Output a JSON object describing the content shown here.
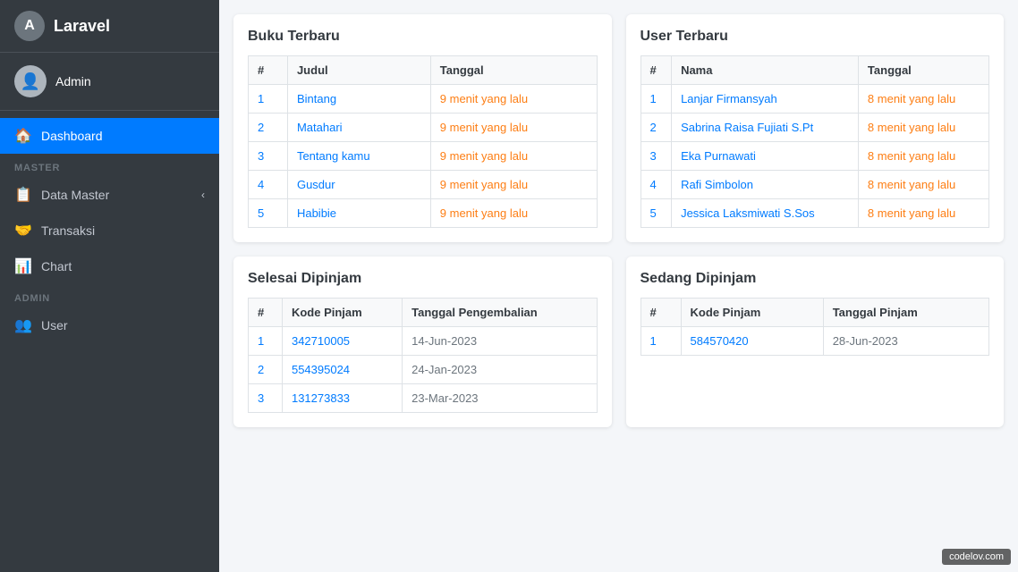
{
  "brand": {
    "logo_letter": "A",
    "name": "Laravel"
  },
  "user": {
    "name": "Admin"
  },
  "sidebar": {
    "items": [
      {
        "id": "dashboard",
        "label": "Dashboard",
        "icon": "🏠",
        "active": true
      },
      {
        "id": "master-label",
        "label": "MASTER",
        "type": "section"
      },
      {
        "id": "data-master",
        "label": "Data Master",
        "icon": "📋",
        "arrow": "‹"
      },
      {
        "id": "transaksi",
        "label": "Transaksi",
        "icon": "🤝"
      },
      {
        "id": "chart",
        "label": "Chart",
        "icon": "📊"
      },
      {
        "id": "admin-label",
        "label": "ADMIN",
        "type": "section"
      },
      {
        "id": "user",
        "label": "User",
        "icon": "👥"
      }
    ]
  },
  "buku_terbaru": {
    "title": "Buku Terbaru",
    "columns": [
      "#",
      "Judul",
      "Tanggal"
    ],
    "rows": [
      {
        "num": "1",
        "judul": "Bintang",
        "tanggal": "9 menit yang lalu"
      },
      {
        "num": "2",
        "judul": "Matahari",
        "tanggal": "9 menit yang lalu"
      },
      {
        "num": "3",
        "judul": "Tentang kamu",
        "tanggal": "9 menit yang lalu"
      },
      {
        "num": "4",
        "judul": "Gusdur",
        "tanggal": "9 menit yang lalu"
      },
      {
        "num": "5",
        "judul": "Habibie",
        "tanggal": "9 menit yang lalu"
      }
    ]
  },
  "user_terbaru": {
    "title": "User Terbaru",
    "columns": [
      "#",
      "Nama",
      "Tanggal"
    ],
    "rows": [
      {
        "num": "1",
        "nama": "Lanjar Firmansyah",
        "tanggal": "8 menit yang lalu"
      },
      {
        "num": "2",
        "nama": "Sabrina Raisa Fujiati S.Pt",
        "tanggal": "8 menit yang lalu"
      },
      {
        "num": "3",
        "nama": "Eka Purnawati",
        "tanggal": "8 menit yang lalu"
      },
      {
        "num": "4",
        "nama": "Rafi Simbolon",
        "tanggal": "8 menit yang lalu"
      },
      {
        "num": "5",
        "nama": "Jessica Laksmiwati S.Sos",
        "tanggal": "8 menit yang lalu"
      }
    ]
  },
  "selesai_dipinjam": {
    "title": "Selesai Dipinjam",
    "columns": [
      "#",
      "Kode Pinjam",
      "Tanggal Pengembalian"
    ],
    "rows": [
      {
        "num": "1",
        "kode": "342710005",
        "tanggal": "14-Jun-2023"
      },
      {
        "num": "2",
        "kode": "554395024",
        "tanggal": "24-Jan-2023"
      },
      {
        "num": "3",
        "kode": "131273833",
        "tanggal": "23-Mar-2023"
      }
    ]
  },
  "sedang_dipinjam": {
    "title": "Sedang Dipinjam",
    "columns": [
      "#",
      "Kode Pinjam",
      "Tanggal Pinjam"
    ],
    "rows": [
      {
        "num": "1",
        "kode": "584570420",
        "tanggal": "28-Jun-2023"
      }
    ]
  },
  "watermark": "codelov.com"
}
